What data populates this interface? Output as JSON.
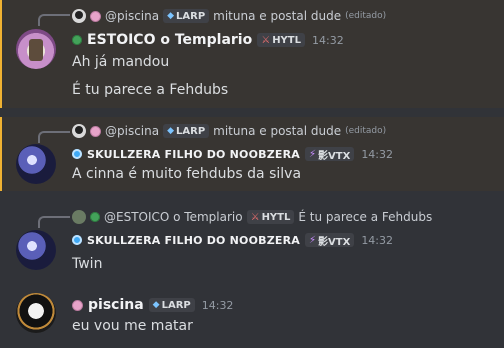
{
  "messages": [
    {
      "reply": {
        "name": "@piscina",
        "tag": "LARP",
        "text": "mituna e postal dude",
        "edited": "(editado)"
      },
      "author": "ESTOICO o Templario",
      "tag": "HYTL",
      "time": "14:32",
      "lines": [
        "Ah já mandou",
        "É tu parece a Fehdubs"
      ]
    },
    {
      "reply": {
        "name": "@piscina",
        "tag": "LARP",
        "text": "mituna e postal dude",
        "edited": "(editado)"
      },
      "author": "SKULLZERA FILHO DO NOOBZERA",
      "tag": "影VTX",
      "time": "14:32",
      "lines": [
        "A cinna é muito fehdubs da silva"
      ]
    },
    {
      "reply": {
        "name": "@ESTOICO o Templario",
        "tag": "HYTL",
        "text": "É tu parece a Fehdubs"
      },
      "author": "SKULLZERA FILHO DO NOOBZERA",
      "tag": "影VTX",
      "time": "14:32",
      "lines": [
        "Twin"
      ]
    },
    {
      "author": "piscina",
      "tag": "LARP",
      "time": "14:32",
      "lines": [
        "eu vou me matar"
      ]
    }
  ],
  "icons": {
    "gem": "gem-icon",
    "sword": "sword-icon",
    "bolt": "lightning-icon"
  },
  "colors": {
    "highlight_bar": "#f0b232",
    "background": "#313338",
    "highlight_bg": "#383532"
  }
}
